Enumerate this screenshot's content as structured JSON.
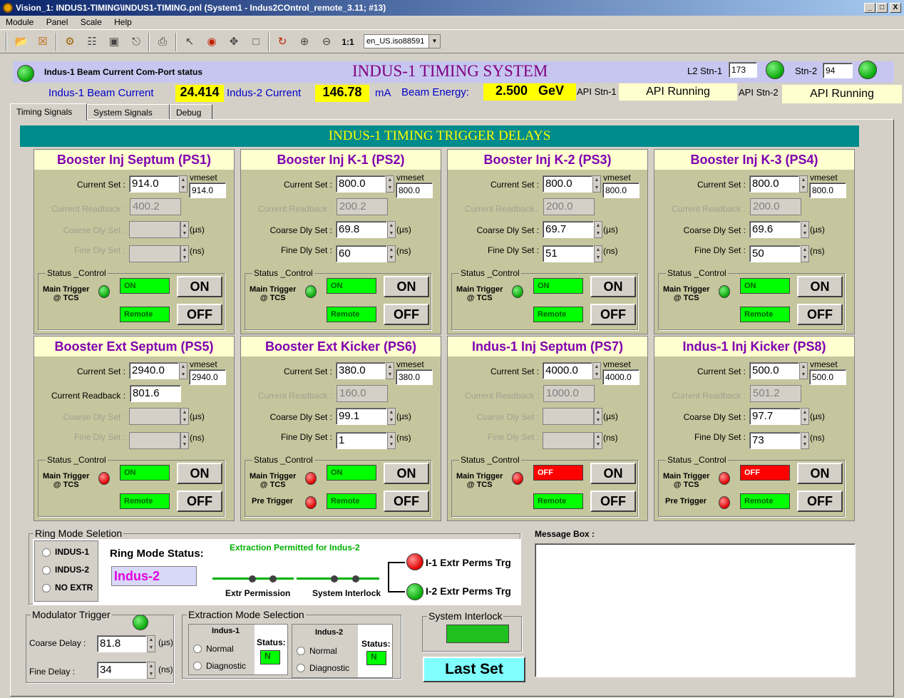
{
  "window": {
    "title": "Vision_1: INDUS1-TIMING\\INDUS1-TIMING.pnl (System1 - Indus2COntrol_remote_3.11; #13)",
    "min": "_",
    "max": "□",
    "close": "X"
  },
  "menu": [
    "Module",
    "Panel",
    "Scale",
    "Help"
  ],
  "toolbar": {
    "zoom_label": "1:1",
    "locale": "en_US.iso88591"
  },
  "header": {
    "com_status": "Indus-1 Beam Current Com-Port status",
    "title": "INDUS-1 TIMING SYSTEM",
    "l2_label": "L2 Stn-1",
    "l2_value": "173",
    "stn2_label": "Stn-2",
    "stn2_value": "94"
  },
  "beam": {
    "i1_label": "Indus-1 Beam Current",
    "i1_value": "24.414",
    "i2_label": "Indus-2 Current",
    "i2_value": "146.78",
    "unit": "mA",
    "energy_label": "Beam Energy:",
    "energy_value": "2.500",
    "energy_unit": "GeV",
    "api1_label": "API Stn-1",
    "api1_value": "API Running",
    "api2_label": "API Stn-2",
    "api2_value": "API Running"
  },
  "tabs": [
    "Timing Signals",
    "System Signals",
    "Debug"
  ],
  "banner": "INDUS-1 TIMING TRIGGER DELAYS",
  "labels": {
    "current_set": "Current Set :",
    "current_readback": "Current Readback :",
    "coarse": "Coarse Dly Set :",
    "fine": "Fine Dly Set :",
    "vmeset": "vmeset",
    "us": "(µs)",
    "ns": "(ns)",
    "status_control": "Status _Control",
    "main_trigger": "Main Trigger",
    "at_tcs": "@ TCS",
    "pre_trigger": "Pre Trigger",
    "on_btn": "ON",
    "off_btn": "OFF"
  },
  "cards": [
    {
      "title": "Booster Inj Septum (PS1)",
      "current_set": "914.0",
      "vmeset": "914.0",
      "readback": "400.2",
      "coarse": "",
      "fine": "",
      "status": "ON",
      "mode": "Remote",
      "trigger_led": "green"
    },
    {
      "title": "Booster Inj K-1 (PS2)",
      "current_set": "800.0",
      "vmeset": "800.0",
      "readback": "200.2",
      "coarse": "69.8",
      "fine": "60",
      "status": "ON",
      "mode": "Remote",
      "trigger_led": "green"
    },
    {
      "title": "Booster Inj K-2 (PS3)",
      "current_set": "800.0",
      "vmeset": "800.0",
      "readback": "200.0",
      "coarse": "69.7",
      "fine": "51",
      "status": "ON",
      "mode": "Remote",
      "trigger_led": "green"
    },
    {
      "title": "Booster Inj K-3 (PS4)",
      "current_set": "800.0",
      "vmeset": "800.0",
      "readback": "200.0",
      "coarse": "69.6",
      "fine": "50",
      "status": "ON",
      "mode": "Remote",
      "trigger_led": "green"
    },
    {
      "title": "Booster Ext Septum (PS5)",
      "current_set": "2940.0",
      "vmeset": "2940.0",
      "readback": "801.6",
      "coarse": "",
      "fine": "",
      "status": "ON",
      "mode": "Remote",
      "trigger_led": "red"
    },
    {
      "title": "Booster Ext Kicker (PS6)",
      "current_set": "380.0",
      "vmeset": "380.0",
      "readback": "160.0",
      "coarse": "99.1",
      "fine": "1",
      "status": "ON",
      "mode": "Remote",
      "trigger_led": "red",
      "pre_led": "red"
    },
    {
      "title": "Indus-1 Inj Septum (PS7)",
      "current_set": "4000.0",
      "vmeset": "4000.0",
      "readback": "1000.0",
      "coarse": "",
      "fine": "",
      "status": "OFF",
      "mode": "Remote",
      "trigger_led": "red"
    },
    {
      "title": "Indus-1 Inj Kicker (PS8)",
      "current_set": "500.0",
      "vmeset": "500.0",
      "readback": "501.2",
      "coarse": "97.7",
      "fine": "73",
      "status": "OFF",
      "mode": "Remote",
      "trigger_led": "red",
      "pre_led": "red"
    }
  ],
  "ring": {
    "legend": "Ring Mode Seletion",
    "opts": [
      "INDUS-1",
      "INDUS-2",
      "NO EXTR"
    ],
    "status_label": "Ring Mode Status:",
    "status_value": "Indus-2",
    "extraction": "Extraction Permitted for Indus-2",
    "extr_perm": "Extr Permission",
    "sys_interlock": "System Interlock",
    "i1": "I-1 Extr Perms Trg",
    "i2": "I-2 Extr Perms Trg"
  },
  "message": {
    "label": "Message Box :"
  },
  "modulator": {
    "legend": "Modulator Trigger",
    "coarse_label": "Coarse Delay :",
    "coarse_value": "81.8",
    "fine_label": "Fine Delay :",
    "fine_value": "34",
    "us": "(µs)",
    "ns": "(ns)"
  },
  "extraction": {
    "legend": "Extraction Mode Selection",
    "i1_title": "Indus-1",
    "i2_title": "Indus-2",
    "normal": "Normal",
    "diagnostic": "Diagnostic",
    "status_label": "Status:",
    "i1_status": "N",
    "i2_status": "N"
  },
  "interlock": {
    "legend": "System Interlock"
  },
  "last_set": "Last Set"
}
